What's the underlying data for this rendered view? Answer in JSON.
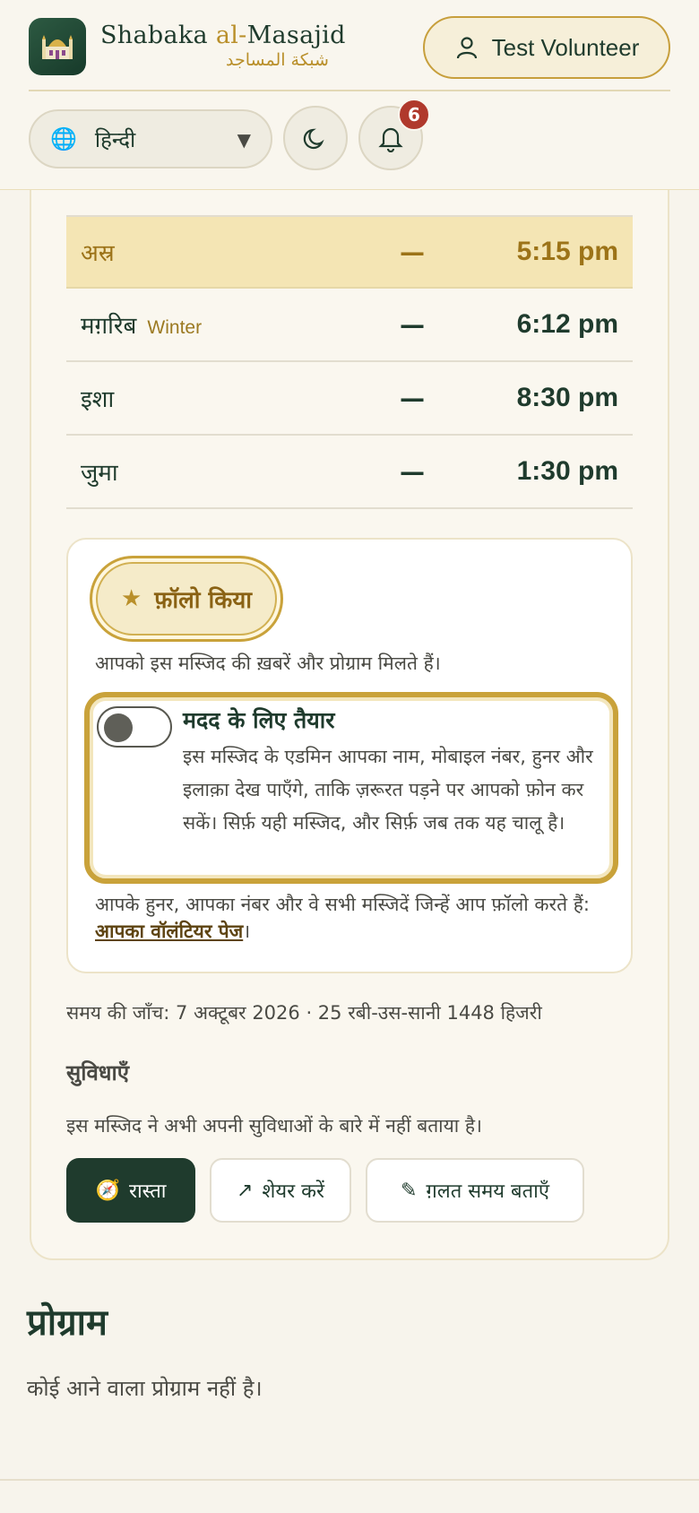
{
  "header": {
    "brand_name_prefix": "Shabaka ",
    "brand_name_al": "al-",
    "brand_name_suffix": "Masajid",
    "brand_subtitle": "شبكة المساجد",
    "user_label": "Test Volunteer",
    "language": "हिन्दी",
    "notification_count": "6",
    "icons": {
      "logo": "mosque-icon",
      "user": "user-icon",
      "globe": "globe-icon",
      "theme": "moon-icon",
      "bell": "bell-icon"
    }
  },
  "prayers": [
    {
      "name": "अस्र",
      "season": "",
      "dash": "—",
      "time": "5:15 pm",
      "active": true
    },
    {
      "name": "मग़रिब",
      "season": "Winter",
      "dash": "—",
      "time": "6:12 pm",
      "active": false
    },
    {
      "name": "इशा",
      "season": "",
      "dash": "—",
      "time": "8:30 pm",
      "active": false
    },
    {
      "name": "जुमा",
      "season": "",
      "dash": "—",
      "time": "1:30 pm",
      "active": false
    }
  ],
  "follow": {
    "button_label": "फ़ॉलो किया",
    "note": "आपको इस मस्जिद की ख़बरें और प्रोग्राम मिलते हैं।",
    "help_title": "मदद के लिए तैयार",
    "help_desc": "इस मस्जिद के एडमिन आपका नाम, मोबाइल नंबर, हुनर और इलाक़ा देख पाएँगे, ताकि ज़रूरत पड़ने पर आपको फ़ोन कर सकें। सिर्फ़ यही मस्जिद, और सिर्फ़ जब तक यह चालू है।",
    "volunteer_note": "आपके हुनर, आपका नंबर और वे सभी मस्जिदें जिन्हें आप फ़ॉलो करते हैं: ",
    "volunteer_link": "आपका वॉलंटियर पेज",
    "volunteer_end": "।"
  },
  "checked": "समय की जाँच: 7 अक्टूबर 2026 · 25 रबी-उस-सानी 1448 हिजरी",
  "facilities": {
    "heading": "सुविधाएँ",
    "text": "इस मस्जिद ने अभी अपनी सुविधाओं के बारे में नहीं बताया है।"
  },
  "actions": {
    "route": "रास्ता",
    "share": "शेयर करें",
    "report": "ग़लत समय बताएँ"
  },
  "programs": {
    "heading": "प्रोग्राम",
    "empty": "कोई आने वाला प्रोग्राम नहीं है।"
  },
  "colors": {
    "accent_green": "#1f3b2d",
    "accent_gold": "#c9a23a",
    "badge_red": "#b0392c",
    "active_row": "#f4e5b4"
  }
}
